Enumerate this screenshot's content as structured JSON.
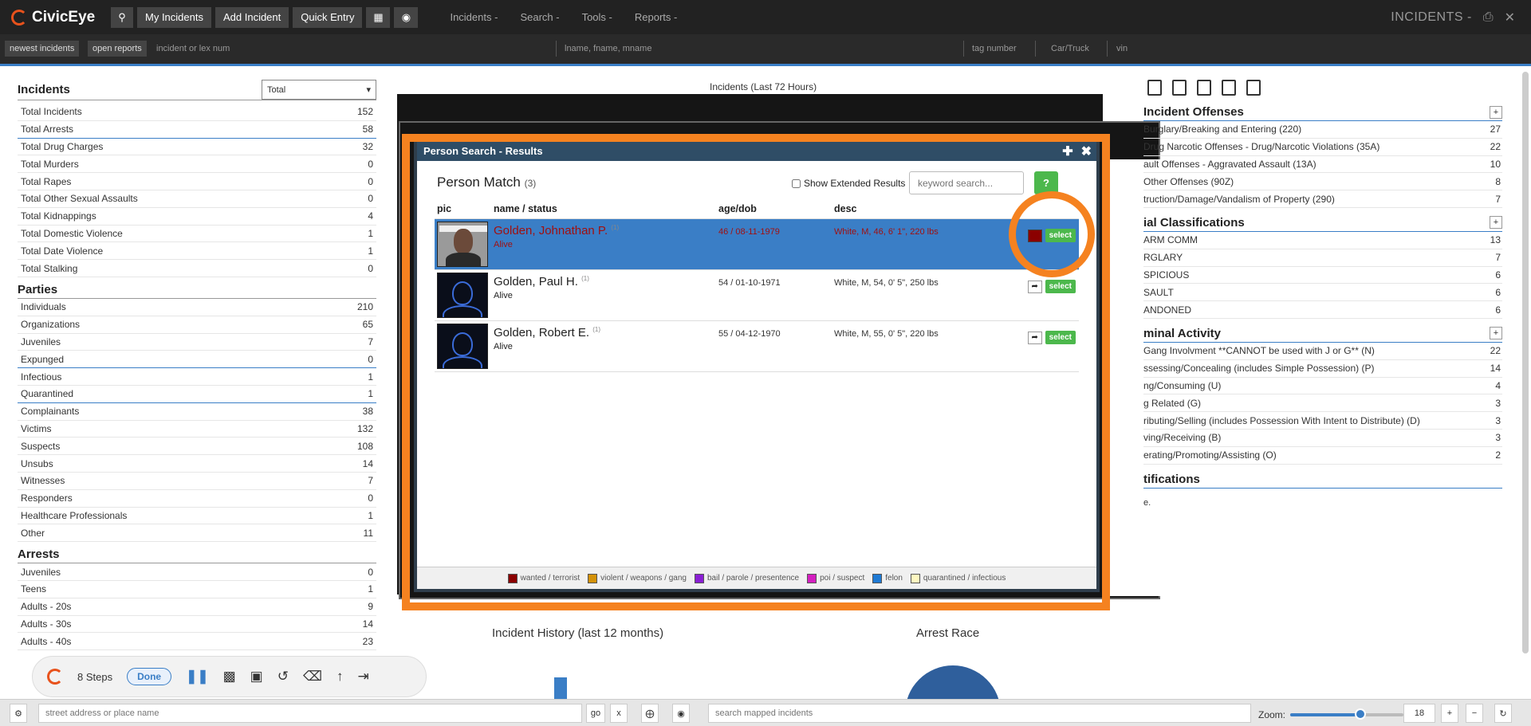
{
  "app": {
    "name": "CivicEye",
    "page_title": "INCIDENTS -"
  },
  "topbar": {
    "buttons": [
      "My Incidents",
      "Add Incident",
      "Quick Entry"
    ],
    "menus": [
      "Incidents -",
      "Search -",
      "Tools -",
      "Reports -"
    ]
  },
  "searchbar": {
    "newest": "newest incidents",
    "open": "open reports",
    "incident_placeholder": "incident or lex num",
    "name_placeholder": "lname, fname, mname",
    "tag_placeholder": "tag number",
    "car": "Car/Truck",
    "vin": "vin"
  },
  "left": {
    "incidents_title": "Incidents",
    "select_value": "Total",
    "incidents": [
      [
        "Total Incidents",
        "152"
      ],
      [
        "Total Arrests",
        "58"
      ],
      [
        "Total Drug Charges",
        "32"
      ],
      [
        "Total Murders",
        "0"
      ],
      [
        "Total Rapes",
        "0"
      ],
      [
        "Total Other Sexual Assaults",
        "0"
      ],
      [
        "Total Kidnappings",
        "4"
      ],
      [
        "Total Domestic Violence",
        "1"
      ],
      [
        "Total Date Violence",
        "1"
      ],
      [
        "Total Stalking",
        "0"
      ]
    ],
    "parties_title": "Parties",
    "parties": [
      [
        "Individuals",
        "210"
      ],
      [
        "Organizations",
        "65"
      ],
      [
        "Juveniles",
        "7"
      ],
      [
        "Expunged",
        "0"
      ],
      [
        "Infectious",
        "1"
      ],
      [
        "Quarantined",
        "1"
      ],
      [
        "Complainants",
        "38"
      ],
      [
        "Victims",
        "132"
      ],
      [
        "Suspects",
        "108"
      ],
      [
        "Unsubs",
        "14"
      ],
      [
        "Witnesses",
        "7"
      ],
      [
        "Responders",
        "0"
      ],
      [
        "Healthcare Professionals",
        "1"
      ],
      [
        "Other",
        "11"
      ]
    ],
    "arrests_title": "Arrests",
    "arrests": [
      [
        "Juveniles",
        "0"
      ],
      [
        "Teens",
        "1"
      ],
      [
        "Adults - 20s",
        "9"
      ],
      [
        "Adults - 30s",
        "14"
      ],
      [
        "Adults - 40s",
        "23"
      ]
    ]
  },
  "center": {
    "chart_title": "Incidents (Last 72 Hours)",
    "history_title": "Incident History (last 12 months)",
    "race_title": "Arrest Race"
  },
  "modal": {
    "title": "Person Search - Results",
    "heading": "Person Match",
    "count": "(3)",
    "extended_label": "Show Extended Results",
    "keyword_placeholder": "keyword search...",
    "help": "?",
    "columns": {
      "pic": "pic",
      "name": "name / status",
      "age": "age/dob",
      "desc": "desc"
    },
    "select_label": "select",
    "results": [
      {
        "name": "Golden, Johnathan P.",
        "sup": "(1)",
        "status": "Alive",
        "age": "46 / 08-11-1979",
        "desc": "White, M, 46, 6' 1\", 220 lbs"
      },
      {
        "name": "Golden, Paul H.",
        "sup": "(1)",
        "status": "Alive",
        "age": "54 / 01-10-1971",
        "desc": "White, M, 54, 0' 5\", 250 lbs"
      },
      {
        "name": "Golden, Robert E.",
        "sup": "(1)",
        "status": "Alive",
        "age": "55 / 04-12-1970",
        "desc": "White, M, 55, 0' 5\", 220 lbs"
      }
    ],
    "legend": [
      {
        "label": "wanted / terrorist",
        "color": "#8b0000"
      },
      {
        "label": "violent / weapons / gang",
        "color": "#d4920a"
      },
      {
        "label": "bail / parole / presentence",
        "color": "#8a1fd4"
      },
      {
        "label": "poi / suspect",
        "color": "#d41fc0"
      },
      {
        "label": "felon",
        "color": "#1f7ad4"
      },
      {
        "label": "quarantined / infectious",
        "color": "#fff8c0"
      }
    ]
  },
  "right": {
    "offenses_title": "Incident Offenses",
    "offenses": [
      [
        "Burglary/Breaking and Entering (220)",
        "27"
      ],
      [
        "Drug Narcotic Offenses - Drug/Narcotic Violations (35A)",
        "22"
      ],
      [
        "ault Offenses - Aggravated Assault (13A)",
        "10"
      ],
      [
        "Other Offenses (90Z)",
        "8"
      ],
      [
        "truction/Damage/Vandalism of Property (290)",
        "7"
      ]
    ],
    "classifications_title": "ial Classifications",
    "classifications": [
      [
        "ARM COMM",
        "13"
      ],
      [
        "RGLARY",
        "7"
      ],
      [
        "SPICIOUS",
        "6"
      ],
      [
        "SAULT",
        "6"
      ],
      [
        "ANDONED",
        "6"
      ]
    ],
    "criminal_title": "minal Activity",
    "criminal": [
      [
        "Gang Involvment **CANNOT be used with J or G** (N)",
        "22"
      ],
      [
        "ssessing/Concealing (includes Simple Possession) (P)",
        "14"
      ],
      [
        "ng/Consuming (U)",
        "4"
      ],
      [
        "g Related (G)",
        "3"
      ],
      [
        "ributing/Selling (includes Possession With Intent to Distribute) (D)",
        "3"
      ],
      [
        "ving/Receiving (B)",
        "3"
      ],
      [
        "erating/Promoting/Assisting (O)",
        "2"
      ]
    ],
    "notifications_title": "tifications",
    "notifications_text": "e."
  },
  "steps": {
    "count": "8 Steps",
    "done": "Done"
  },
  "bottom": {
    "address_placeholder": "street address or place name",
    "go": "go",
    "x": "x",
    "mapped_placeholder": "search mapped incidents",
    "zoom_label": "Zoom:",
    "zoom_value": "18",
    "zoom_level": 0.62
  }
}
